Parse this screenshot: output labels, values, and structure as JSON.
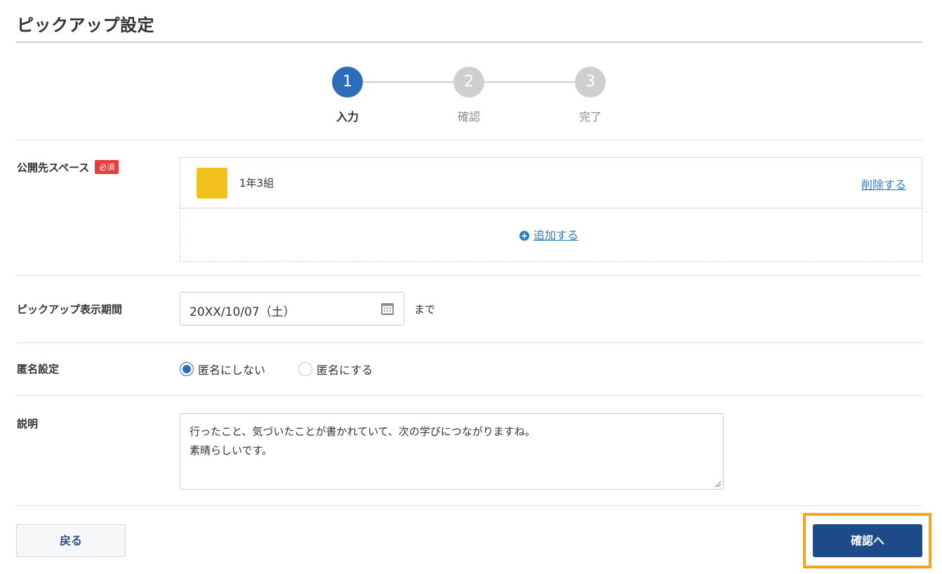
{
  "page": {
    "title": "ピックアップ設定"
  },
  "stepper": {
    "steps": [
      {
        "number": "1",
        "label": "入力",
        "active": true
      },
      {
        "number": "2",
        "label": "確認",
        "active": false
      },
      {
        "number": "3",
        "label": "完了",
        "active": false
      }
    ]
  },
  "space_section": {
    "label": "公開先スペース",
    "required_badge": "必須",
    "item": {
      "name": "1年3組",
      "swatch_color": "#f1c21b",
      "delete_label": "削除する"
    },
    "add_label": "追加する"
  },
  "period_section": {
    "label": "ピックアップ表示期間",
    "date_value": "20XX/10/07（土）",
    "suffix": "まで"
  },
  "anonymous_section": {
    "label": "匿名設定",
    "options": [
      {
        "label": "匿名にしない",
        "checked": true
      },
      {
        "label": "匿名にする",
        "checked": false
      }
    ]
  },
  "description_section": {
    "label": "説明",
    "lines": [
      "行ったこと、気づいたことが書かれていて、次の学びにつながりますね。",
      "素晴らしいです。"
    ]
  },
  "footer": {
    "back_label": "戻る",
    "confirm_label": "確認へ"
  },
  "colors": {
    "accent": "#2c6cb9",
    "primary_button": "#1d4b8a",
    "highlight": "#f5a31a",
    "required": "#e33d3d"
  }
}
